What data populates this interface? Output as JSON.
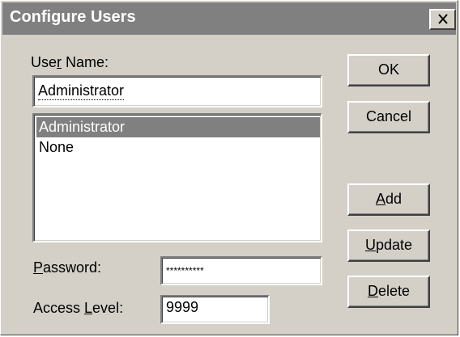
{
  "window": {
    "title": "Configure Users"
  },
  "user_name": {
    "label_pre": "Use",
    "label_mnemonic": "r",
    "label_post": " Name:",
    "value": "Administrator"
  },
  "users_list": {
    "items": [
      "Administrator",
      "None"
    ],
    "selected": "Administrator"
  },
  "password": {
    "label_mnemonic": "P",
    "label_post": "assword:",
    "value": "**********"
  },
  "access_level": {
    "label_pre": "Access ",
    "label_mnemonic": "L",
    "label_post": "evel:",
    "value": "9999"
  },
  "buttons": {
    "ok": "OK",
    "cancel": "Cancel",
    "add_mnemonic": "A",
    "add_rest": "dd",
    "update_mnemonic": "U",
    "update_rest": "pdate",
    "delete_mnemonic": "D",
    "delete_rest": "elete"
  },
  "colors": {
    "dialog_face": "#d4d0c8",
    "titlebar": "#808080",
    "selection": "#808080"
  }
}
